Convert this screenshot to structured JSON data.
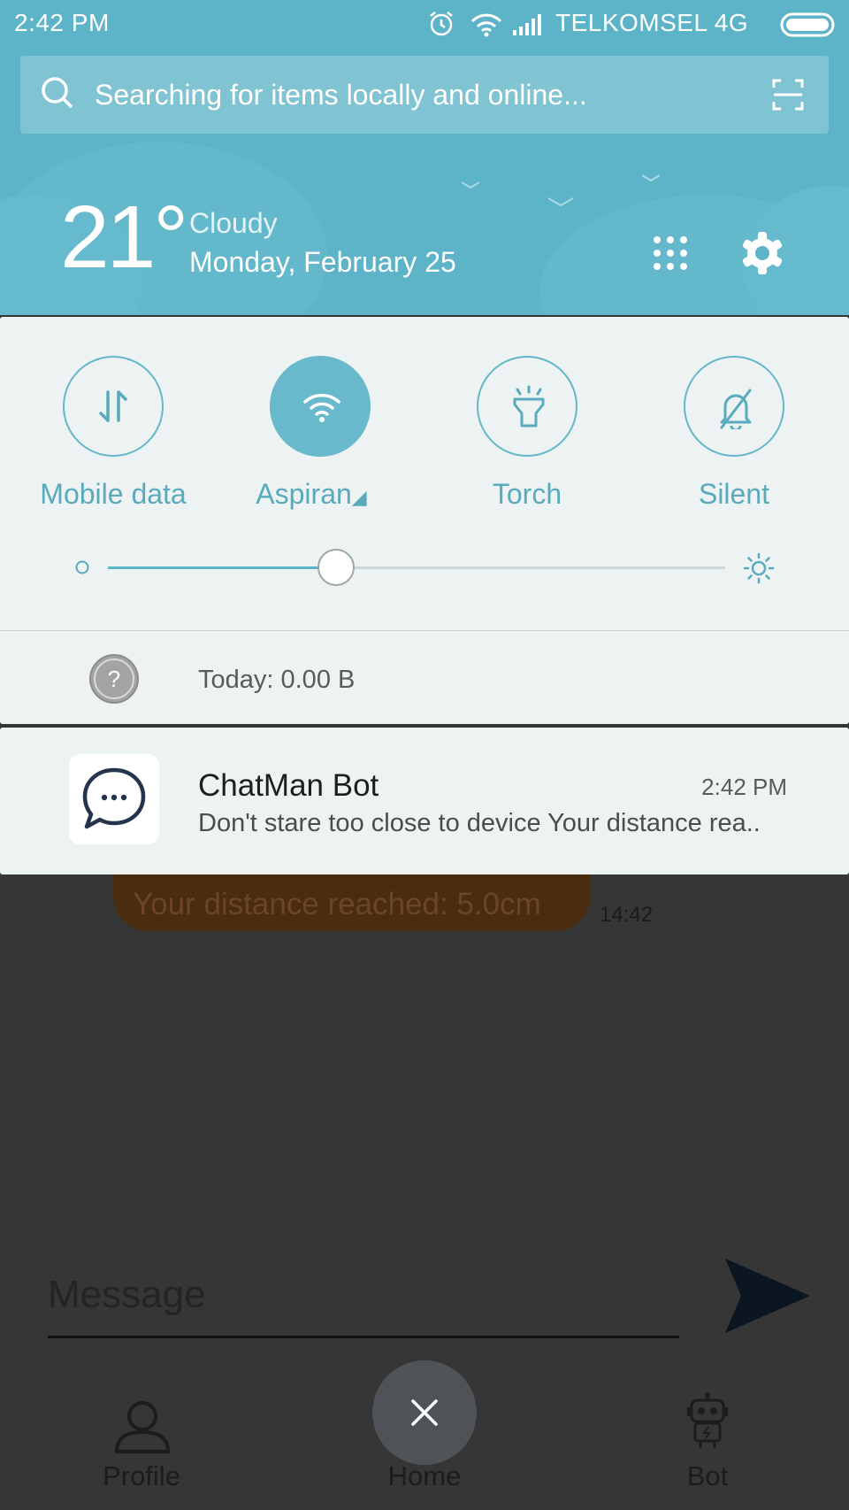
{
  "status_bar": {
    "time": "2:42 PM",
    "carrier": "TELKOMSEL 4G"
  },
  "search": {
    "placeholder": "Searching for items locally and online..."
  },
  "weather": {
    "temperature": "21°",
    "condition": "Cloudy",
    "date": "Monday, February 25"
  },
  "quick_settings": {
    "toggles": [
      {
        "label": "Mobile data",
        "icon": "mobile-data-icon",
        "active": false
      },
      {
        "label": "Aspiran",
        "icon": "wifi-icon",
        "active": true
      },
      {
        "label": "Torch",
        "icon": "flashlight-icon",
        "active": false
      },
      {
        "label": "Silent",
        "icon": "bell-off-icon",
        "active": false
      }
    ],
    "brightness": 0.37,
    "accent_color": "#5db3c7"
  },
  "data_usage": {
    "text": "Today: 0.00 B"
  },
  "notification": {
    "app_name": "ChatMan Bot",
    "time": "2:42 PM",
    "body": "Don't stare too close to device Your distance rea.."
  },
  "chat": {
    "bubble_text": "Your distance reached: 5.0cm",
    "bubble_time": "14:42",
    "message_placeholder": "Message"
  },
  "bottom_nav": {
    "profile": "Profile",
    "home": "Home",
    "bot": "Bot"
  }
}
